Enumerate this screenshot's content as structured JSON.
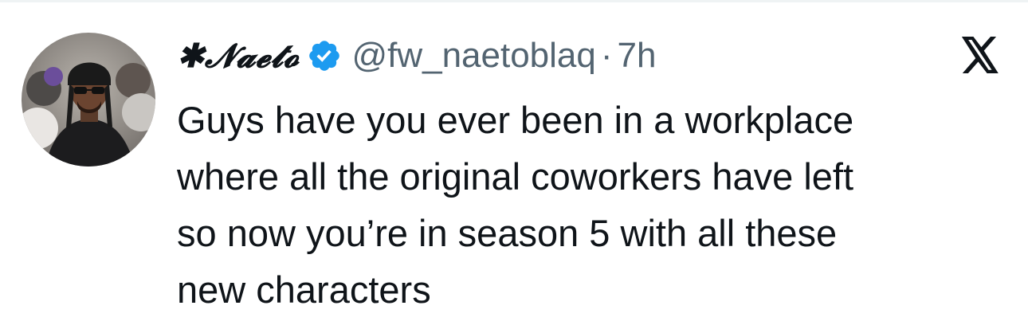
{
  "post": {
    "author": {
      "display_name": "✱𝓝𝓪𝓮𝓽𝓸",
      "handle": "@fw_naetoblaq",
      "verified": true,
      "avatar_icon": "profile-photo"
    },
    "separator": "·",
    "timestamp": "7h",
    "platform_icon": "x-logo-icon",
    "text_lines": [
      "Guys have you ever been in a workplace",
      "where all the original coworkers have left",
      "so now you’re in season 5 with all these",
      "new characters"
    ]
  },
  "colors": {
    "text": "#0f1419",
    "secondary_text": "#536471",
    "verified_badge": "#1d9bf0",
    "divider": "#eff3f4",
    "background": "#ffffff"
  }
}
